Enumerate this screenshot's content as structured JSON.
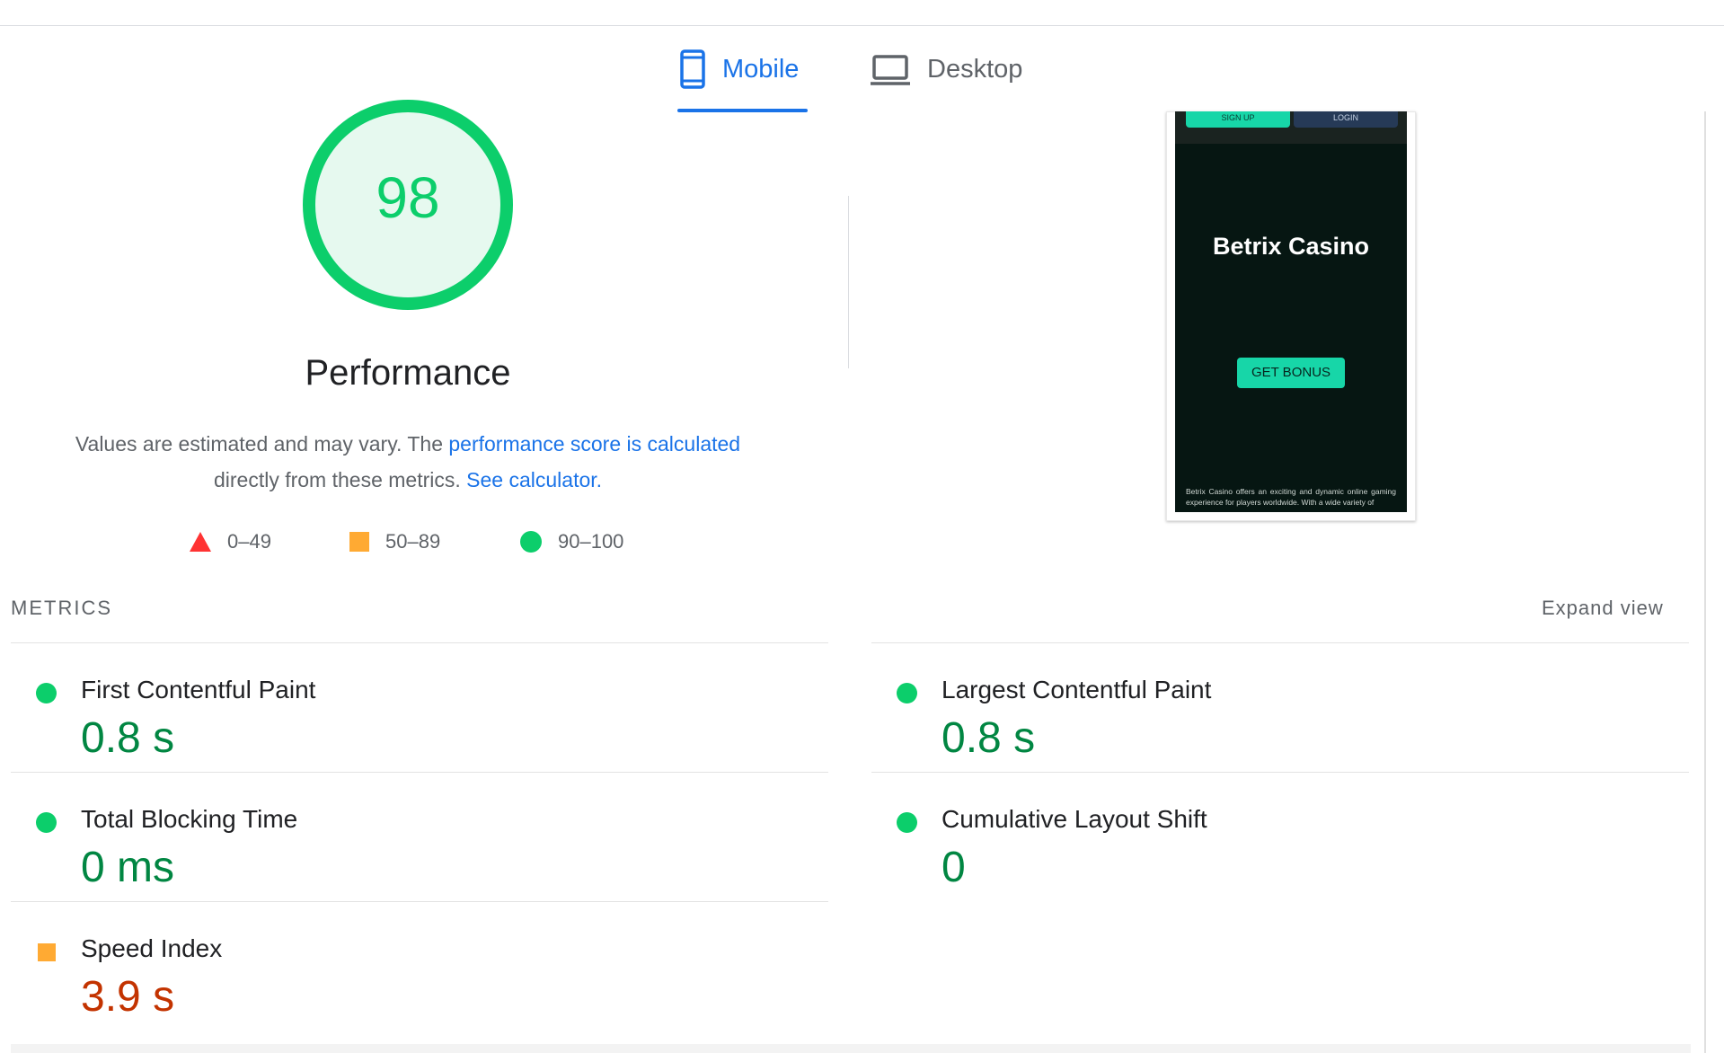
{
  "tabs": {
    "mobile": {
      "label": "Mobile",
      "icon": "smartphone-icon",
      "active": true
    },
    "desktop": {
      "label": "Desktop",
      "icon": "laptop-icon",
      "active": false
    }
  },
  "score": {
    "value": "98",
    "title": "Performance",
    "desc_prefix": "Values are estimated and may vary. The ",
    "desc_link1": "performance score is calculated",
    "desc_middle": "directly from these metrics. ",
    "desc_link2": "See calculator."
  },
  "legend": [
    {
      "range": "0–49",
      "shape": "triangle",
      "color": "#ff3333"
    },
    {
      "range": "50–89",
      "shape": "square",
      "color": "#ffaa33"
    },
    {
      "range": "90–100",
      "shape": "circle",
      "color": "#0cce6b"
    }
  ],
  "screenshot": {
    "signup": "SIGN UP",
    "login": "LOGIN",
    "title": "Betrix Casino",
    "cta": "GET BONUS",
    "text": "Betrix Casino offers an exciting and dynamic online gaming experience for players worldwide. With a wide variety of"
  },
  "metrics": {
    "heading": "METRICS",
    "expand": "Expand view",
    "items": [
      {
        "title": "First Contentful Paint",
        "value": "0.8 s",
        "status": "good"
      },
      {
        "title": "Largest Contentful Paint",
        "value": "0.8 s",
        "status": "good"
      },
      {
        "title": "Total Blocking Time",
        "value": "0 ms",
        "status": "good"
      },
      {
        "title": "Cumulative Layout Shift",
        "value": "0",
        "status": "good"
      },
      {
        "title": "Speed Index",
        "value": "3.9 s",
        "status": "average"
      }
    ]
  },
  "colors": {
    "accent": "#1a73e8",
    "good": "#0cce6b",
    "good_text": "#018642",
    "average": "#ffaa33",
    "average_text": "#c33300",
    "fail": "#ff3333"
  }
}
